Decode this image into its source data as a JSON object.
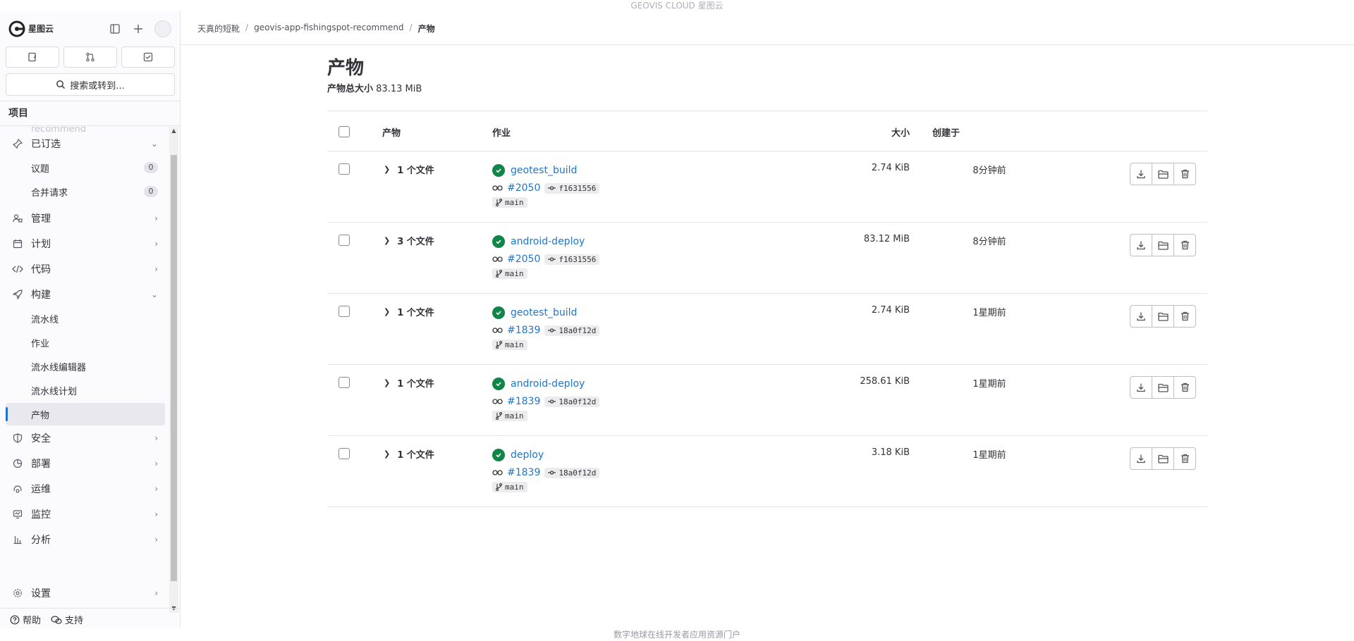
{
  "top_banner": "GEOVIS CLOUD 星图云",
  "bottom_banner": "数字地球在线开发者应用资源门户",
  "sidebar": {
    "logo_text": "星图云",
    "search_label": "搜索或转到...",
    "section_title": "项目",
    "faded_item": "recommend",
    "pinned": {
      "label": "已订选",
      "items": [
        {
          "label": "议题",
          "count": "0"
        },
        {
          "label": "合并请求",
          "count": "0"
        }
      ]
    },
    "nav": [
      {
        "label": "管理",
        "icon": "users-icon"
      },
      {
        "label": "计划",
        "icon": "calendar-icon"
      },
      {
        "label": "代码",
        "icon": "code-icon"
      },
      {
        "label": "构建",
        "icon": "rocket-icon"
      }
    ],
    "build_items": [
      {
        "label": "流水线"
      },
      {
        "label": "作业"
      },
      {
        "label": "流水线编辑器"
      },
      {
        "label": "流水线计划"
      },
      {
        "label": "产物"
      }
    ],
    "nav_after": [
      {
        "label": "安全",
        "icon": "shield-icon"
      },
      {
        "label": "部署",
        "icon": "deploy-icon"
      },
      {
        "label": "运维",
        "icon": "monitor-icon"
      },
      {
        "label": "监控",
        "icon": "chart-icon"
      },
      {
        "label": "分析",
        "icon": "analytics-icon"
      }
    ],
    "settings_label": "设置",
    "help_label": "帮助",
    "support_label": "支持"
  },
  "breadcrumb": [
    "天真的短靴",
    "geovis-app-fishingspot-recommend",
    "产物"
  ],
  "page": {
    "title": "产物",
    "total_size_label": "产物总大小",
    "total_size_value": "83.13 MiB"
  },
  "table": {
    "headers": {
      "artifacts": "产物",
      "job": "作业",
      "size": "大小",
      "created": "创建于"
    },
    "rows": [
      {
        "files": "1 个文件",
        "job": "geotest_build",
        "pipeline": "#2050",
        "sha": "f1631556",
        "branch": "main",
        "size": "2.74 KiB",
        "created": "8分钟前"
      },
      {
        "files": "3 个文件",
        "job": "android-deploy",
        "pipeline": "#2050",
        "sha": "f1631556",
        "branch": "main",
        "size": "83.12 MiB",
        "created": "8分钟前"
      },
      {
        "files": "1 个文件",
        "job": "geotest_build",
        "pipeline": "#1839",
        "sha": "18a0f12d",
        "branch": "main",
        "size": "2.74 KiB",
        "created": "1星期前"
      },
      {
        "files": "1 个文件",
        "job": "android-deploy",
        "pipeline": "#1839",
        "sha": "18a0f12d",
        "branch": "main",
        "size": "258.61 KiB",
        "created": "1星期前"
      },
      {
        "files": "1 个文件",
        "job": "deploy",
        "pipeline": "#1839",
        "sha": "18a0f12d",
        "branch": "main",
        "size": "3.18 KiB",
        "created": "1星期前"
      }
    ]
  },
  "colors": {
    "link": "#1f75cb",
    "success": "#108548",
    "active_bar": "#1f75cb"
  }
}
